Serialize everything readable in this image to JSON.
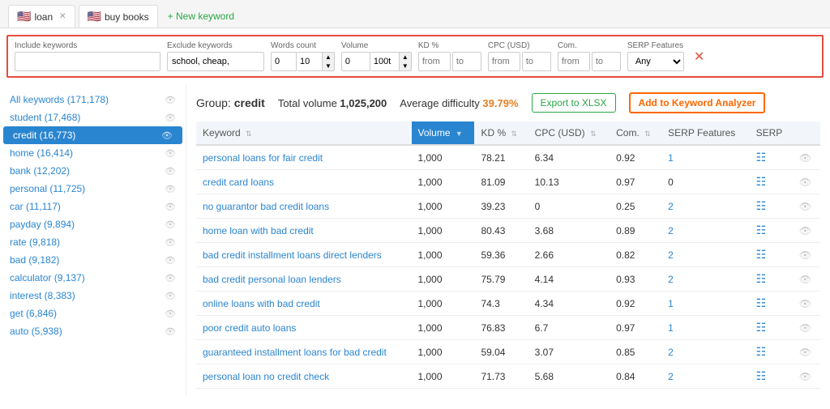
{
  "tabs": [
    {
      "id": "loan",
      "label": "loan",
      "flag": "🇺🇸",
      "closable": true
    },
    {
      "id": "buy-books",
      "label": "buy books",
      "flag": "🇺🇸",
      "closable": false
    }
  ],
  "new_keyword_label": "New keyword",
  "filters": {
    "include_label": "Include keywords",
    "include_value": "",
    "include_placeholder": "",
    "exclude_label": "Exclude keywords",
    "exclude_value": "school, cheap,",
    "words_count_label": "Words count",
    "words_from": "0",
    "words_to": "10",
    "volume_label": "Volume",
    "volume_from": "0",
    "volume_to": "100t",
    "kd_label": "KD %",
    "kd_from": "from",
    "kd_to": "to",
    "cpc_label": "CPC (USD)",
    "cpc_from": "from",
    "cpc_to": "to",
    "com_label": "Com.",
    "com_from": "from",
    "com_to": "to",
    "serp_label": "SERP Features",
    "serp_value": "Any"
  },
  "group": {
    "label": "Group:",
    "name": "credit",
    "total_volume_label": "Total volume",
    "total_volume": "1,025,200",
    "avg_difficulty_label": "Average difficulty",
    "avg_difficulty": "39.79%"
  },
  "buttons": {
    "export": "Export to XLSX",
    "analyzer": "Add to Keyword Analyzer"
  },
  "table": {
    "columns": [
      {
        "id": "keyword",
        "label": "Keyword"
      },
      {
        "id": "volume",
        "label": "Volume"
      },
      {
        "id": "kd",
        "label": "KD %"
      },
      {
        "id": "cpc",
        "label": "CPC (USD)"
      },
      {
        "id": "com",
        "label": "Com."
      },
      {
        "id": "serp_features",
        "label": "SERP Features"
      },
      {
        "id": "serp",
        "label": "SERP"
      }
    ],
    "rows": [
      {
        "keyword": "personal loans for fair credit",
        "volume": "1,000",
        "kd": "78.21",
        "cpc": "6.34",
        "com": "0.92",
        "serp_features": "1"
      },
      {
        "keyword": "credit card loans",
        "volume": "1,000",
        "kd": "81.09",
        "cpc": "10.13",
        "com": "0.97",
        "serp_features": "0"
      },
      {
        "keyword": "no guarantor bad credit loans",
        "volume": "1,000",
        "kd": "39.23",
        "cpc": "0",
        "com": "0.25",
        "serp_features": "2"
      },
      {
        "keyword": "home loan with bad credit",
        "volume": "1,000",
        "kd": "80.43",
        "cpc": "3.68",
        "com": "0.89",
        "serp_features": "2"
      },
      {
        "keyword": "bad credit installment loans direct lenders",
        "volume": "1,000",
        "kd": "59.36",
        "cpc": "2.66",
        "com": "0.82",
        "serp_features": "2"
      },
      {
        "keyword": "bad credit personal loan lenders",
        "volume": "1,000",
        "kd": "75.79",
        "cpc": "4.14",
        "com": "0.93",
        "serp_features": "2"
      },
      {
        "keyword": "online loans with bad credit",
        "volume": "1,000",
        "kd": "74.3",
        "cpc": "4.34",
        "com": "0.92",
        "serp_features": "1"
      },
      {
        "keyword": "poor credit auto loans",
        "volume": "1,000",
        "kd": "76.83",
        "cpc": "6.7",
        "com": "0.97",
        "serp_features": "1"
      },
      {
        "keyword": "guaranteed installment loans for bad credit",
        "volume": "1,000",
        "kd": "59.04",
        "cpc": "3.07",
        "com": "0.85",
        "serp_features": "2"
      },
      {
        "keyword": "personal loan no credit check",
        "volume": "1,000",
        "kd": "71.73",
        "cpc": "5.68",
        "com": "0.84",
        "serp_features": "2"
      }
    ]
  },
  "sidebar": {
    "items": [
      {
        "id": "all-keywords",
        "label": "All keywords (171,178)"
      },
      {
        "id": "student",
        "label": "student (17,468)"
      },
      {
        "id": "credit",
        "label": "credit (16,773)",
        "active": true
      },
      {
        "id": "home",
        "label": "home (16,414)"
      },
      {
        "id": "bank",
        "label": "bank (12,202)"
      },
      {
        "id": "personal",
        "label": "personal (11,725)"
      },
      {
        "id": "car",
        "label": "car (11,117)"
      },
      {
        "id": "payday",
        "label": "payday (9,894)"
      },
      {
        "id": "rate",
        "label": "rate (9,818)"
      },
      {
        "id": "bad",
        "label": "bad (9,182)"
      },
      {
        "id": "calculator",
        "label": "calculator (9,137)"
      },
      {
        "id": "interest",
        "label": "interest (8,383)"
      },
      {
        "id": "get",
        "label": "get (6,846)"
      },
      {
        "id": "auto",
        "label": "auto (5,938)"
      }
    ]
  }
}
